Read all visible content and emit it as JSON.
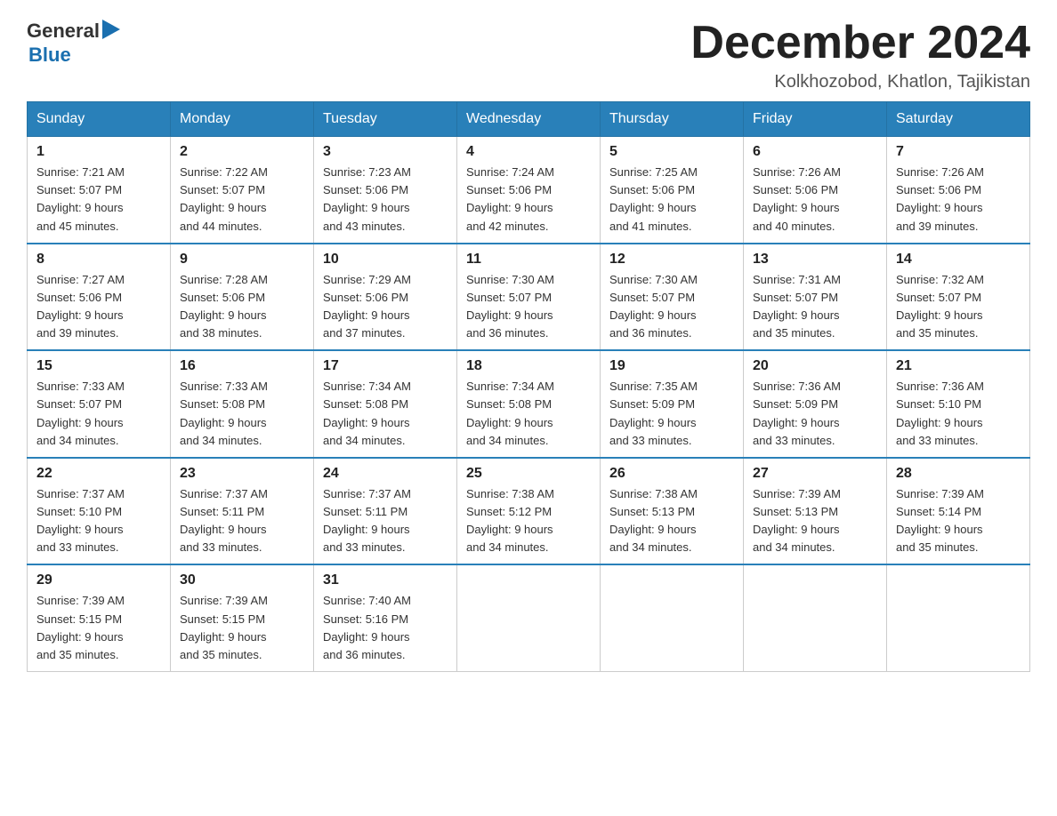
{
  "logo": {
    "general": "General",
    "arrow": "▶",
    "blue": "Blue"
  },
  "header": {
    "title": "December 2024",
    "location": "Kolkhozobod, Khatlon, Tajikistan"
  },
  "days_of_week": [
    "Sunday",
    "Monday",
    "Tuesday",
    "Wednesday",
    "Thursday",
    "Friday",
    "Saturday"
  ],
  "weeks": [
    [
      {
        "day": "1",
        "sunrise": "7:21 AM",
        "sunset": "5:07 PM",
        "daylight": "9 hours and 45 minutes."
      },
      {
        "day": "2",
        "sunrise": "7:22 AM",
        "sunset": "5:07 PM",
        "daylight": "9 hours and 44 minutes."
      },
      {
        "day": "3",
        "sunrise": "7:23 AM",
        "sunset": "5:06 PM",
        "daylight": "9 hours and 43 minutes."
      },
      {
        "day": "4",
        "sunrise": "7:24 AM",
        "sunset": "5:06 PM",
        "daylight": "9 hours and 42 minutes."
      },
      {
        "day": "5",
        "sunrise": "7:25 AM",
        "sunset": "5:06 PM",
        "daylight": "9 hours and 41 minutes."
      },
      {
        "day": "6",
        "sunrise": "7:26 AM",
        "sunset": "5:06 PM",
        "daylight": "9 hours and 40 minutes."
      },
      {
        "day": "7",
        "sunrise": "7:26 AM",
        "sunset": "5:06 PM",
        "daylight": "9 hours and 39 minutes."
      }
    ],
    [
      {
        "day": "8",
        "sunrise": "7:27 AM",
        "sunset": "5:06 PM",
        "daylight": "9 hours and 39 minutes."
      },
      {
        "day": "9",
        "sunrise": "7:28 AM",
        "sunset": "5:06 PM",
        "daylight": "9 hours and 38 minutes."
      },
      {
        "day": "10",
        "sunrise": "7:29 AM",
        "sunset": "5:06 PM",
        "daylight": "9 hours and 37 minutes."
      },
      {
        "day": "11",
        "sunrise": "7:30 AM",
        "sunset": "5:07 PM",
        "daylight": "9 hours and 36 minutes."
      },
      {
        "day": "12",
        "sunrise": "7:30 AM",
        "sunset": "5:07 PM",
        "daylight": "9 hours and 36 minutes."
      },
      {
        "day": "13",
        "sunrise": "7:31 AM",
        "sunset": "5:07 PM",
        "daylight": "9 hours and 35 minutes."
      },
      {
        "day": "14",
        "sunrise": "7:32 AM",
        "sunset": "5:07 PM",
        "daylight": "9 hours and 35 minutes."
      }
    ],
    [
      {
        "day": "15",
        "sunrise": "7:33 AM",
        "sunset": "5:07 PM",
        "daylight": "9 hours and 34 minutes."
      },
      {
        "day": "16",
        "sunrise": "7:33 AM",
        "sunset": "5:08 PM",
        "daylight": "9 hours and 34 minutes."
      },
      {
        "day": "17",
        "sunrise": "7:34 AM",
        "sunset": "5:08 PM",
        "daylight": "9 hours and 34 minutes."
      },
      {
        "day": "18",
        "sunrise": "7:34 AM",
        "sunset": "5:08 PM",
        "daylight": "9 hours and 34 minutes."
      },
      {
        "day": "19",
        "sunrise": "7:35 AM",
        "sunset": "5:09 PM",
        "daylight": "9 hours and 33 minutes."
      },
      {
        "day": "20",
        "sunrise": "7:36 AM",
        "sunset": "5:09 PM",
        "daylight": "9 hours and 33 minutes."
      },
      {
        "day": "21",
        "sunrise": "7:36 AM",
        "sunset": "5:10 PM",
        "daylight": "9 hours and 33 minutes."
      }
    ],
    [
      {
        "day": "22",
        "sunrise": "7:37 AM",
        "sunset": "5:10 PM",
        "daylight": "9 hours and 33 minutes."
      },
      {
        "day": "23",
        "sunrise": "7:37 AM",
        "sunset": "5:11 PM",
        "daylight": "9 hours and 33 minutes."
      },
      {
        "day": "24",
        "sunrise": "7:37 AM",
        "sunset": "5:11 PM",
        "daylight": "9 hours and 33 minutes."
      },
      {
        "day": "25",
        "sunrise": "7:38 AM",
        "sunset": "5:12 PM",
        "daylight": "9 hours and 34 minutes."
      },
      {
        "day": "26",
        "sunrise": "7:38 AM",
        "sunset": "5:13 PM",
        "daylight": "9 hours and 34 minutes."
      },
      {
        "day": "27",
        "sunrise": "7:39 AM",
        "sunset": "5:13 PM",
        "daylight": "9 hours and 34 minutes."
      },
      {
        "day": "28",
        "sunrise": "7:39 AM",
        "sunset": "5:14 PM",
        "daylight": "9 hours and 35 minutes."
      }
    ],
    [
      {
        "day": "29",
        "sunrise": "7:39 AM",
        "sunset": "5:15 PM",
        "daylight": "9 hours and 35 minutes."
      },
      {
        "day": "30",
        "sunrise": "7:39 AM",
        "sunset": "5:15 PM",
        "daylight": "9 hours and 35 minutes."
      },
      {
        "day": "31",
        "sunrise": "7:40 AM",
        "sunset": "5:16 PM",
        "daylight": "9 hours and 36 minutes."
      },
      null,
      null,
      null,
      null
    ]
  ]
}
